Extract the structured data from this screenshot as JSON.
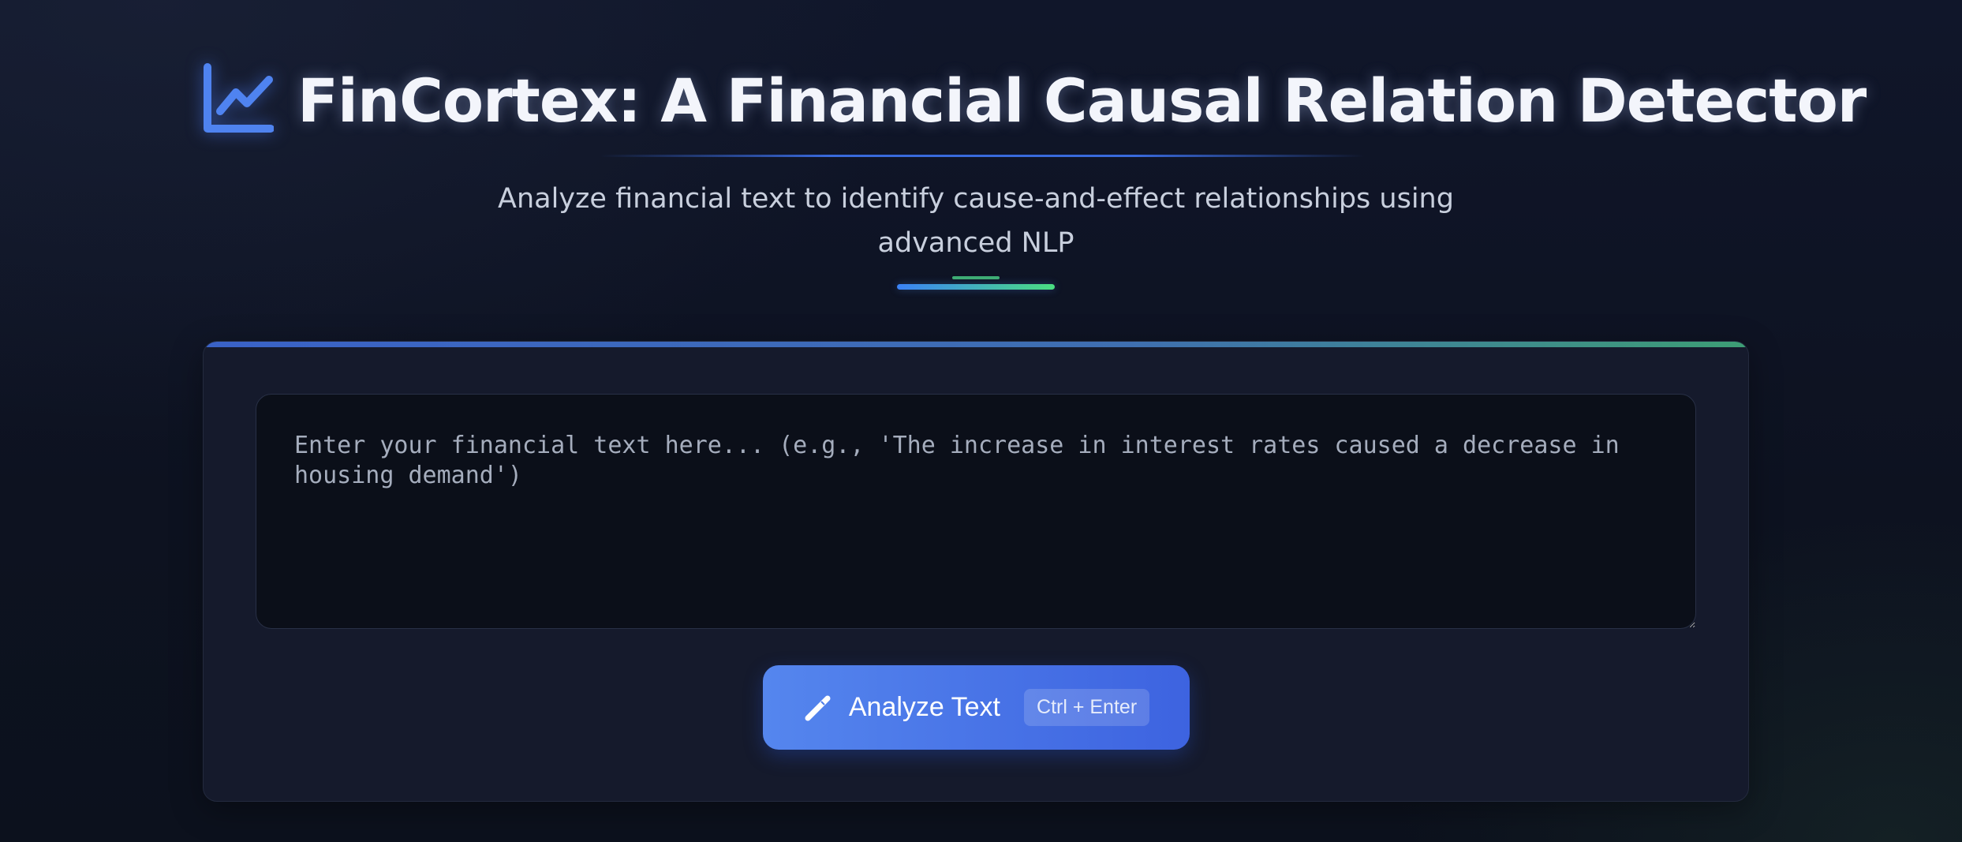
{
  "header": {
    "icon": "line-chart-icon",
    "title": "FinCortex: A Financial Causal Relation Detector",
    "subtitle": "Analyze financial text to identify cause-and-effect relationships using advanced NLP"
  },
  "colors": {
    "background": "#0d1220",
    "card": "#151a2c",
    "input_background": "#0b0f19",
    "accent_blue": "#3b6fe6",
    "accent_green": "#4ade80",
    "title_text": "#f3f5fb"
  },
  "input": {
    "value": "",
    "placeholder": "Enter your financial text here... (e.g., 'The increase in interest rates caused a decrease in housing demand')"
  },
  "analyze_button": {
    "icon": "magic-wand-icon",
    "label": "Analyze Text",
    "shortcut": "Ctrl + Enter"
  }
}
